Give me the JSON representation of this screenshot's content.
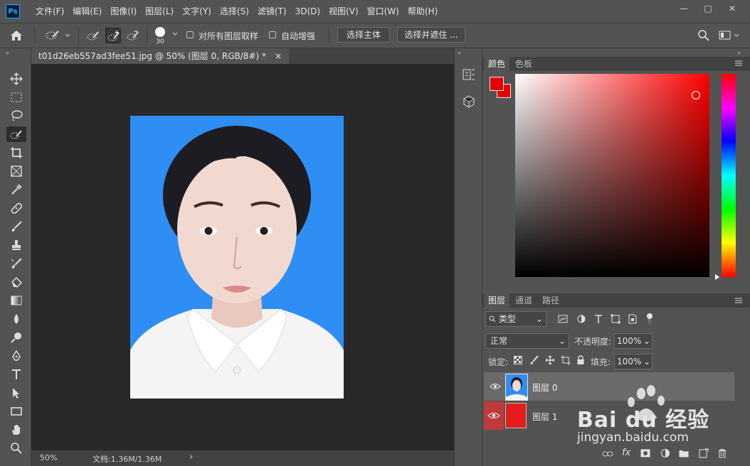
{
  "app": {
    "logo": "Ps"
  },
  "menu": [
    "文件(F)",
    "编辑(E)",
    "图像(I)",
    "图层(L)",
    "文字(Y)",
    "选择(S)",
    "滤镜(T)",
    "3D(D)",
    "视图(V)",
    "窗口(W)",
    "帮助(H)"
  ],
  "window_controls": [
    "—",
    "□",
    "✕"
  ],
  "options": {
    "brush_size": "30",
    "sample_all_layers": "对所有图层取样",
    "auto_enhance": "自动增强",
    "select_subject": "选择主体",
    "select_and_mask": "选择并遮住 ..."
  },
  "document": {
    "tab_title": "t01d26eb557ad3fee51.jpg @ 50% (图层 0, RGB/8#) *",
    "close": "×"
  },
  "status": {
    "zoom": "50%",
    "doc_size": "文档:1.36M/1.36M",
    "arrow": "›"
  },
  "color_panel": {
    "tabs": [
      "颜色",
      "色板"
    ],
    "foreground": "#e50000",
    "background": "#e50000"
  },
  "layers_panel": {
    "tabs": [
      "图层",
      "通道",
      "路径"
    ],
    "filter_kind": "类型",
    "blend_mode": "正常",
    "opacity_label": "不透明度:",
    "opacity": "100%",
    "lock_label": "锁定:",
    "fill_label": "填充:",
    "fill": "100%",
    "layers": [
      {
        "name": "图层 0",
        "thumb": "photo",
        "selected": true
      },
      {
        "name": "图层 1",
        "thumb_color": "#e51c1c",
        "selected": false
      }
    ]
  },
  "watermark": {
    "brand": "Bai du 经验",
    "url": "jingyan.baidu.com"
  },
  "colors": {
    "accent_selected_layer": "#bf3b3b",
    "photo_bg": "#2f8ef3"
  }
}
